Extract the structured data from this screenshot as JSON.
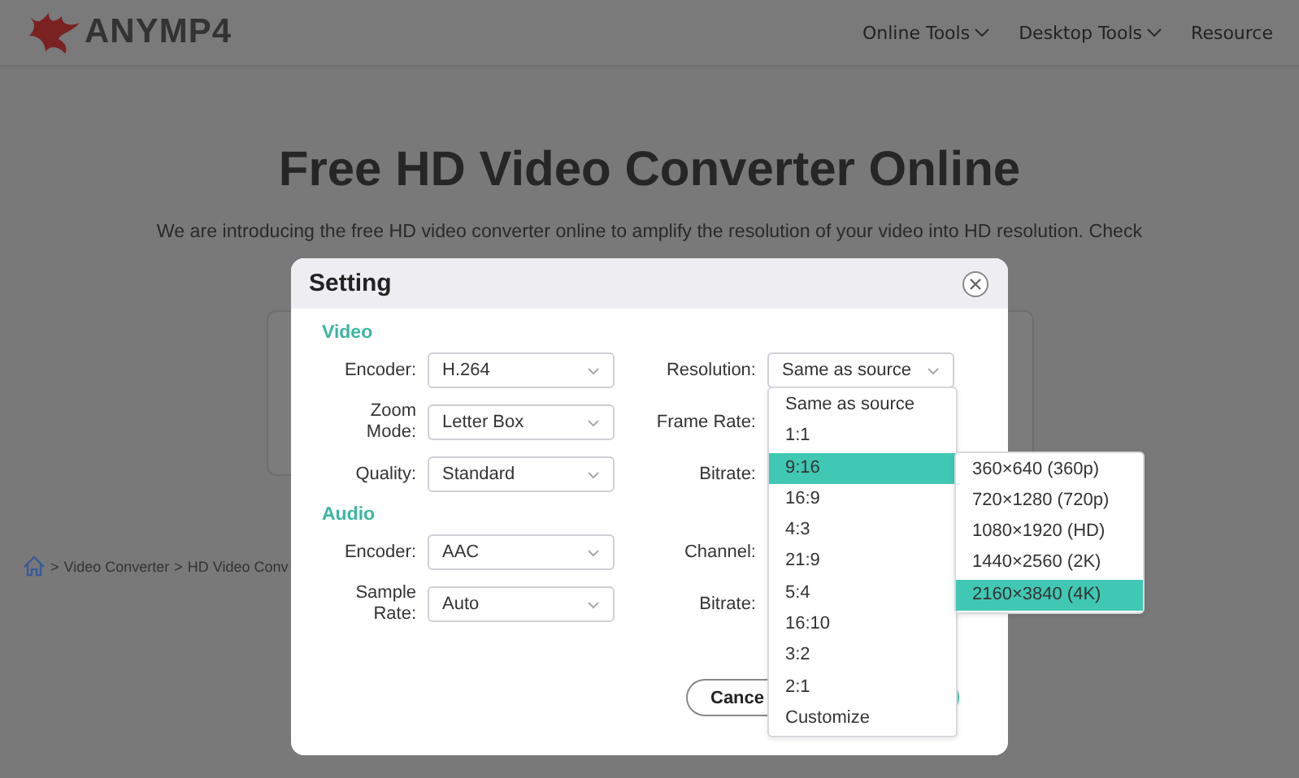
{
  "header": {
    "brand": "ANYMP4",
    "nav": [
      {
        "label": "Online Tools",
        "dropdown": true
      },
      {
        "label": "Desktop Tools",
        "dropdown": true
      },
      {
        "label": "Resource",
        "dropdown": false
      }
    ]
  },
  "page": {
    "title": "Free HD Video Converter Online",
    "intro": "We are introducing the free HD video converter online to amplify the resolution of your video into HD resolution. Check",
    "breadcrumb": [
      {
        "separator": ">",
        "label": "Video Converter"
      },
      {
        "separator": ">",
        "label": "HD Video Conv"
      }
    ]
  },
  "dialog": {
    "title": "Setting",
    "sections": [
      {
        "heading": "Video",
        "rows": [
          {
            "label": "Encoder:",
            "value": "H.264",
            "right_label": "Resolution:",
            "right_value": "Same as source"
          },
          {
            "label": "Zoom Mode:",
            "value": "Letter Box",
            "right_label": "Frame Rate:"
          },
          {
            "label": "Quality:",
            "value": "Standard",
            "right_label": "Bitrate:"
          }
        ]
      },
      {
        "heading": "Audio",
        "rows": [
          {
            "label": "Encoder:",
            "value": "AAC",
            "right_label": "Channel:"
          },
          {
            "label": "Sample Rate:",
            "value": "Auto",
            "right_label": "Bitrate:"
          }
        ]
      }
    ],
    "buttons": [
      {
        "kind": "secondary",
        "label": "Cance"
      },
      {
        "kind": "primary"
      }
    ]
  },
  "resolution_menu": {
    "items": [
      {
        "label": "Same as source",
        "selected": false
      },
      {
        "label": "1:1",
        "selected": false
      },
      {
        "label": "9:16",
        "selected": true
      },
      {
        "label": "16:9",
        "selected": false
      },
      {
        "label": "4:3",
        "selected": false
      },
      {
        "label": "21:9",
        "selected": false
      },
      {
        "label": "5:4",
        "selected": false
      },
      {
        "label": "16:10",
        "selected": false
      },
      {
        "label": "3:2",
        "selected": false
      },
      {
        "label": "2:1",
        "selected": false
      },
      {
        "label": "Customize",
        "selected": false
      }
    ]
  },
  "submenu": {
    "items": [
      {
        "label": "360×640 (360p)",
        "selected": false
      },
      {
        "label": "720×1280 (720p)",
        "selected": false
      },
      {
        "label": "1080×1920 (HD)",
        "selected": false
      },
      {
        "label": "1440×2560 (2K)",
        "selected": false
      },
      {
        "label": "2160×3840 (4K)",
        "selected": true
      }
    ]
  }
}
